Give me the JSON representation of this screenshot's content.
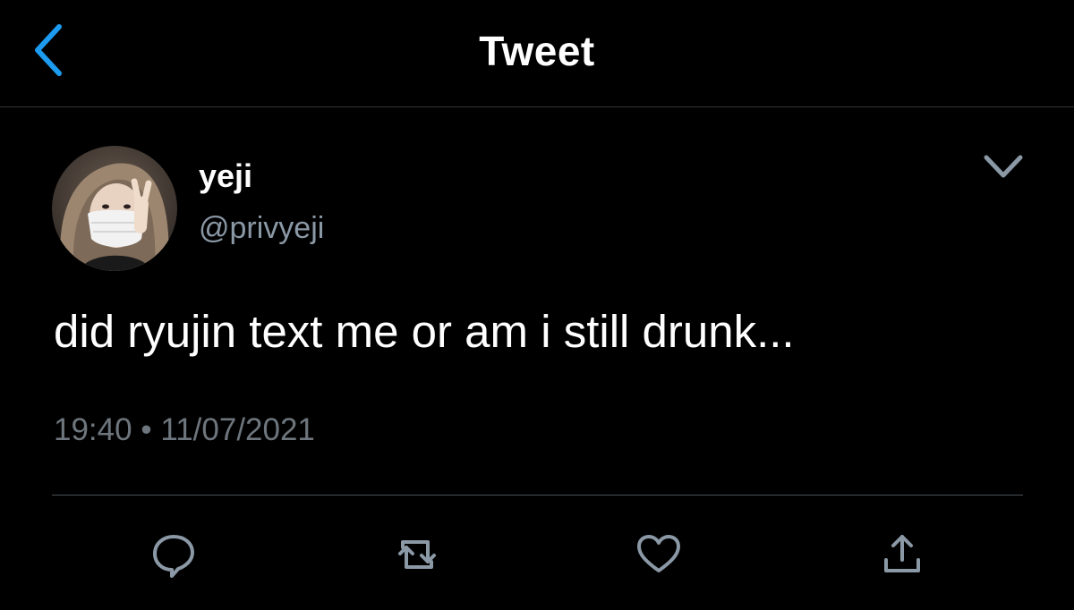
{
  "header": {
    "title": "Tweet",
    "back_icon": "chevron-left-icon",
    "accent_color": "#1d9bf0"
  },
  "tweet": {
    "display_name": "yeji",
    "handle": "@privyeji",
    "text": "did ryujin text me or am i still drunk...",
    "time": "19:40",
    "separator": "•",
    "date": "11/07/2021",
    "more_icon": "chevron-down-icon"
  },
  "actions": [
    {
      "name": "reply",
      "icon": "reply-icon"
    },
    {
      "name": "retweet",
      "icon": "retweet-icon"
    },
    {
      "name": "like",
      "icon": "heart-icon"
    },
    {
      "name": "share",
      "icon": "share-icon"
    }
  ],
  "colors": {
    "background": "#000000",
    "text": "#ffffff",
    "secondary_text": "#8b98a5",
    "icon": "#8b98a5"
  }
}
